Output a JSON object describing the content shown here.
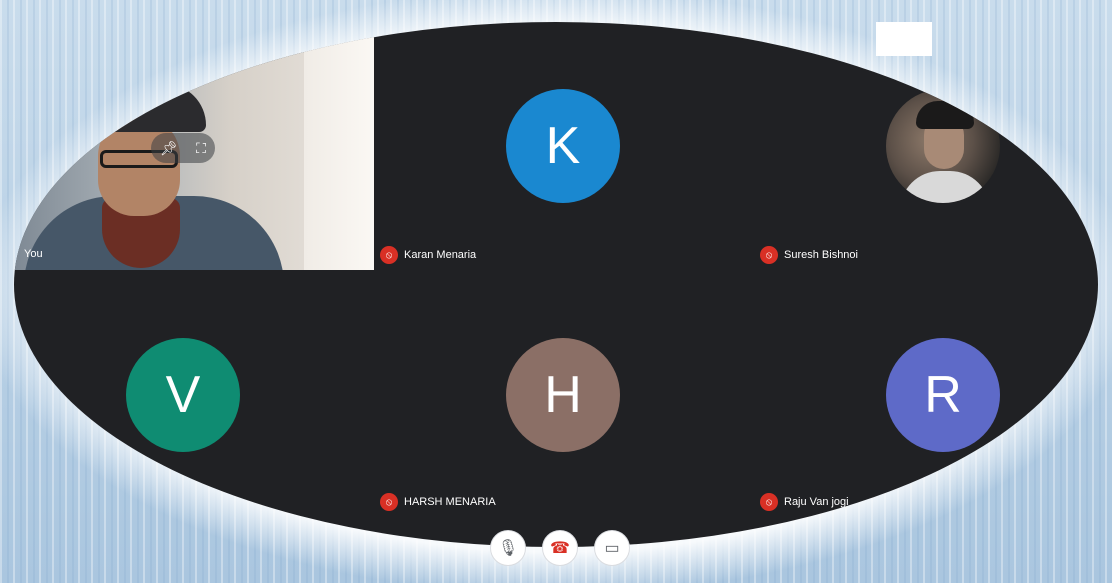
{
  "participants": [
    {
      "name": "You",
      "type": "video"
    },
    {
      "name": "Karan Menaria",
      "initial": "K",
      "color": "#1a88d0",
      "muted": true
    },
    {
      "name": "Suresh Bishnoi",
      "type": "photo",
      "muted": true
    },
    {
      "name": "",
      "initial": "V",
      "color": "#0f8c72",
      "muted": false
    },
    {
      "name": "HARSH MENARIA",
      "initial": "H",
      "color": "#8b6f66",
      "muted": true
    },
    {
      "name": "Raju Van jogi",
      "initial": "R",
      "color": "#5e6ac8",
      "muted": true
    }
  ],
  "self_controls": {
    "pin_icon": "pin-icon",
    "fullscreen_icon": "fullscreen-icon"
  },
  "controls": {
    "mic_icon": "mic-icon",
    "end_call_icon": "end-call-icon",
    "camera_icon": "camera-icon"
  }
}
